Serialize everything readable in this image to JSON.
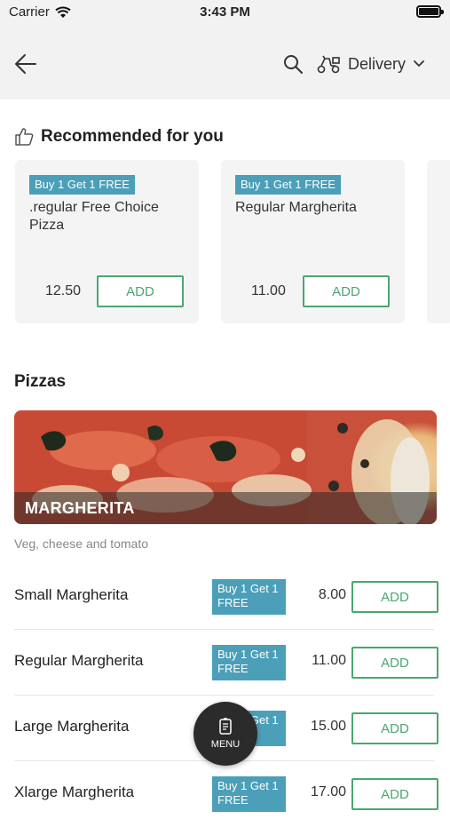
{
  "status_bar": {
    "carrier": "Carrier",
    "time": "3:43 PM"
  },
  "header": {
    "delivery_label": "Delivery",
    "icons": [
      "back-arrow-icon",
      "search-icon",
      "scooter-icon",
      "chevron-down-icon"
    ]
  },
  "recommended": {
    "title": "Recommended for you",
    "icon": "thumbs-up-icon",
    "items": [
      {
        "badge": "Buy 1 Get 1 FREE",
        "name": ".regular Free Choice Pizza",
        "price": "12.50",
        "add_label": "ADD"
      },
      {
        "badge": "Buy 1 Get 1 FREE",
        "name": "Regular Margherita",
        "price": "11.00",
        "add_label": "ADD"
      }
    ]
  },
  "pizzas": {
    "title": "Pizzas",
    "banner_label": "MARGHERITA",
    "description": "Veg, cheese and tomato",
    "items": [
      {
        "name": "Small Margherita",
        "badge": "Buy 1 Get 1 FREE",
        "price": "8.00",
        "add_label": "ADD"
      },
      {
        "name": "Regular Margherita",
        "badge": "Buy 1 Get 1 FREE",
        "price": "11.00",
        "add_label": "ADD"
      },
      {
        "name": "Large Margherita",
        "badge": "Buy 1 Get 1 FREE",
        "price": "15.00",
        "add_label": "ADD"
      },
      {
        "name": "Xlarge Margherita",
        "badge": "Buy 1 Get 1 FREE",
        "price": "17.00",
        "add_label": "ADD"
      }
    ]
  },
  "fab": {
    "label": "MENU",
    "icon": "menu-card-icon"
  },
  "colors": {
    "accent_green": "#49a770",
    "badge_blue": "#4b9fb8",
    "header_bg": "#f2f2f2",
    "fab_bg": "#2b2b2b"
  }
}
